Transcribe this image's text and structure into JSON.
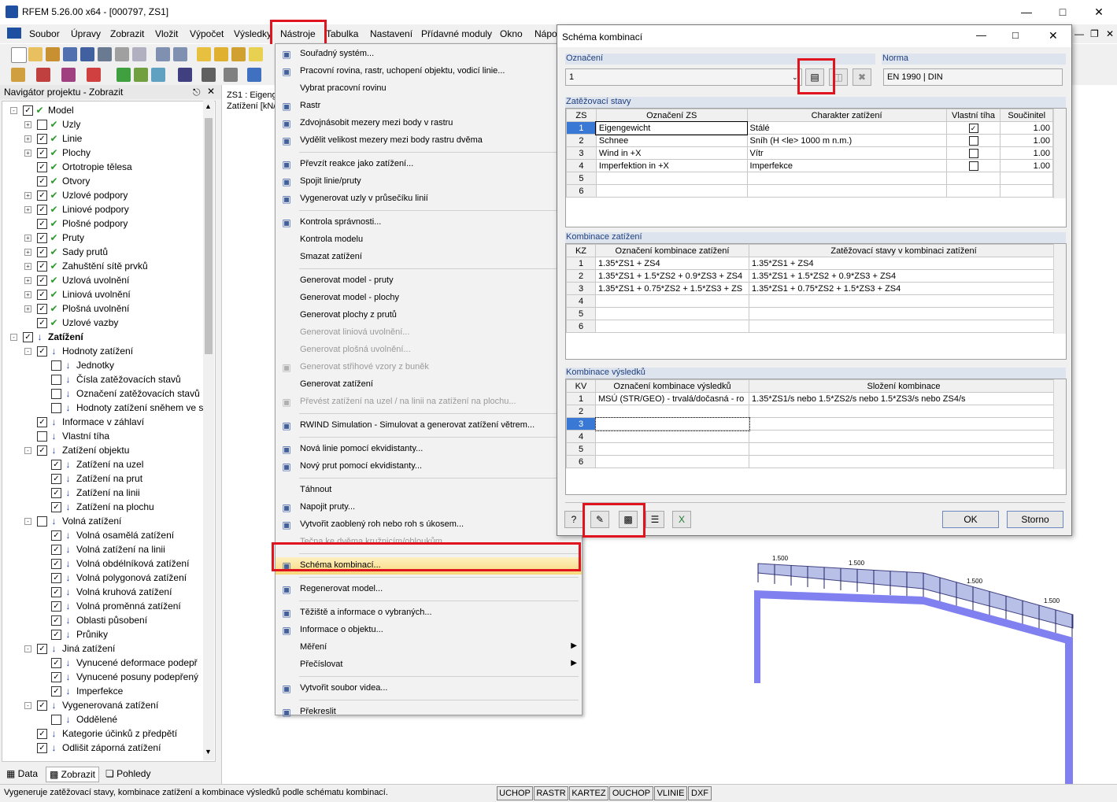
{
  "app": {
    "title": "RFEM 5.26.00 x64 - [000797, ZS1]"
  },
  "menubar": {
    "items": [
      "Soubor",
      "Úpravy",
      "Zobrazit",
      "Vložit",
      "Výpočet",
      "Výsledky",
      "Nástroje",
      "Tabulka",
      "Nastavení",
      "Přídavné moduly",
      "Okno",
      "Nápo"
    ]
  },
  "navigator": {
    "title": "Navigátor projektu - Zobrazit",
    "tree": [
      {
        "label": "Model",
        "level": 0,
        "exp": "-",
        "cb": "x",
        "icon": "model-icon"
      },
      {
        "label": "Uzly",
        "level": 1,
        "exp": "+",
        "cb": "",
        "icon": "check-icon"
      },
      {
        "label": "Linie",
        "level": 1,
        "exp": "+",
        "cb": "x",
        "icon": "check-icon"
      },
      {
        "label": "Plochy",
        "level": 1,
        "exp": "+",
        "cb": "x",
        "icon": "check-icon"
      },
      {
        "label": "Ortotropie tělesa",
        "level": 1,
        "exp": "",
        "cb": "x",
        "icon": "check-icon"
      },
      {
        "label": "Otvory",
        "level": 1,
        "exp": "",
        "cb": "x",
        "icon": "check-icon"
      },
      {
        "label": "Uzlové podpory",
        "level": 1,
        "exp": "+",
        "cb": "x",
        "icon": "check-icon"
      },
      {
        "label": "Liniové podpory",
        "level": 1,
        "exp": "+",
        "cb": "x",
        "icon": "check-icon"
      },
      {
        "label": "Plošné podpory",
        "level": 1,
        "exp": "",
        "cb": "x",
        "icon": "check-icon"
      },
      {
        "label": "Pruty",
        "level": 1,
        "exp": "+",
        "cb": "x",
        "icon": "check-icon"
      },
      {
        "label": "Sady prutů",
        "level": 1,
        "exp": "+",
        "cb": "x",
        "icon": "check-icon"
      },
      {
        "label": "Zahuštění sítě prvků",
        "level": 1,
        "exp": "+",
        "cb": "x",
        "icon": "check-icon"
      },
      {
        "label": "Uzlová uvolnění",
        "level": 1,
        "exp": "+",
        "cb": "x",
        "icon": "check-icon"
      },
      {
        "label": "Liniová uvolnění",
        "level": 1,
        "exp": "+",
        "cb": "x",
        "icon": "check-icon"
      },
      {
        "label": "Plošná uvolnění",
        "level": 1,
        "exp": "+",
        "cb": "x",
        "icon": "check-icon"
      },
      {
        "label": "Uzlové vazby",
        "level": 1,
        "exp": "",
        "cb": "x",
        "icon": "check-icon"
      },
      {
        "label": "Zatížení",
        "level": 0,
        "exp": "-",
        "cb": "x",
        "icon": "load-icon",
        "bold": true
      },
      {
        "label": "Hodnoty zatížení",
        "level": 1,
        "exp": "-",
        "cb": "x",
        "icon": "load-icon"
      },
      {
        "label": "Jednotky",
        "level": 2,
        "exp": "",
        "cb": "",
        "icon": "load-icon"
      },
      {
        "label": "Čísla zatěžovacích stavů",
        "level": 2,
        "exp": "",
        "cb": "",
        "icon": "load-icon"
      },
      {
        "label": "Označení zatěžovacích stavů",
        "level": 2,
        "exp": "",
        "cb": "",
        "icon": "load-icon"
      },
      {
        "label": "Hodnoty zatížení sněhem ve s",
        "level": 2,
        "exp": "",
        "cb": "",
        "icon": "load-icon"
      },
      {
        "label": "Informace v záhlaví",
        "level": 1,
        "exp": "",
        "cb": "x",
        "icon": "load-icon"
      },
      {
        "label": "Vlastní tíha",
        "level": 1,
        "exp": "",
        "cb": "",
        "icon": "load-icon"
      },
      {
        "label": "Zatížení objektu",
        "level": 1,
        "exp": "-",
        "cb": "x",
        "icon": "load-icon"
      },
      {
        "label": "Zatížení na uzel",
        "level": 2,
        "exp": "",
        "cb": "x",
        "icon": "load-icon"
      },
      {
        "label": "Zatížení na prut",
        "level": 2,
        "exp": "",
        "cb": "x",
        "icon": "load-icon"
      },
      {
        "label": "Zatížení na linii",
        "level": 2,
        "exp": "",
        "cb": "x",
        "icon": "load-icon"
      },
      {
        "label": "Zatížení na plochu",
        "level": 2,
        "exp": "",
        "cb": "x",
        "icon": "load-icon"
      },
      {
        "label": "Volná zatížení",
        "level": 1,
        "exp": "-",
        "cb": "",
        "icon": "load-icon"
      },
      {
        "label": "Volná osamělá zatížení",
        "level": 2,
        "exp": "",
        "cb": "x",
        "icon": "load-icon"
      },
      {
        "label": "Volná zatížení na linii",
        "level": 2,
        "exp": "",
        "cb": "x",
        "icon": "load-icon"
      },
      {
        "label": "Volná obdélníková zatížení",
        "level": 2,
        "exp": "",
        "cb": "x",
        "icon": "load-icon"
      },
      {
        "label": "Volná polygonová zatížení",
        "level": 2,
        "exp": "",
        "cb": "x",
        "icon": "load-icon"
      },
      {
        "label": "Volná kruhová zatížení",
        "level": 2,
        "exp": "",
        "cb": "x",
        "icon": "load-icon"
      },
      {
        "label": "Volná proměnná zatížení",
        "level": 2,
        "exp": "",
        "cb": "x",
        "icon": "load-icon"
      },
      {
        "label": "Oblasti působení",
        "level": 2,
        "exp": "",
        "cb": "x",
        "icon": "load-icon"
      },
      {
        "label": "Průniky",
        "level": 2,
        "exp": "",
        "cb": "x",
        "icon": "load-icon"
      },
      {
        "label": "Jiná zatížení",
        "level": 1,
        "exp": "-",
        "cb": "x",
        "icon": "load-icon"
      },
      {
        "label": "Vynucené deformace podepř",
        "level": 2,
        "exp": "",
        "cb": "x",
        "icon": "load-icon"
      },
      {
        "label": "Vynucené posuny podepřený",
        "level": 2,
        "exp": "",
        "cb": "x",
        "icon": "load-icon"
      },
      {
        "label": "Imperfekce",
        "level": 2,
        "exp": "",
        "cb": "x",
        "icon": "load-icon"
      },
      {
        "label": "Vygenerovaná zatížení",
        "level": 1,
        "exp": "-",
        "cb": "x",
        "icon": "load-icon"
      },
      {
        "label": "Oddělené",
        "level": 2,
        "exp": "",
        "cb": "",
        "icon": "load-icon"
      },
      {
        "label": "Kategorie účinků z předpětí",
        "level": 1,
        "exp": "",
        "cb": "x",
        "icon": "load-icon"
      },
      {
        "label": "Odlišit záporná zatížení",
        "level": 1,
        "exp": "",
        "cb": "x",
        "icon": "load-icon"
      }
    ],
    "tabs": [
      "Data",
      "Zobrazit",
      "Pohledy"
    ]
  },
  "workarea": {
    "line1": "ZS1 : Eigeng",
    "line2": "Zatížení [kN/",
    "load_labels": [
      "1.500",
      "1.500",
      "1.500",
      "1.500"
    ]
  },
  "toolsmenu": {
    "items": [
      {
        "label": "Souřadný systém...",
        "icon": "coordinate-icon"
      },
      {
        "label": "Pracovní rovina, rastr, uchopení objektu, vodicí linie...",
        "icon": "workplane-icon"
      },
      {
        "label": "Vybrat pracovní rovinu",
        "icon": ""
      },
      {
        "label": "Rastr",
        "icon": "grid-icon"
      },
      {
        "label": "Zdvojnásobit mezery mezi body v rastru",
        "icon": "double-icon"
      },
      {
        "label": "Vydělit velikost mezery mezi body rastru dvěma",
        "icon": "halve-icon"
      },
      {
        "sep": true
      },
      {
        "label": "Převzít reakce jako zatížení...",
        "icon": "reaction-icon"
      },
      {
        "label": "Spojit linie/pruty",
        "icon": "connect-icon"
      },
      {
        "label": "Vygenerovat uzly v průsečíku linií",
        "icon": "intersect-icon"
      },
      {
        "sep": true
      },
      {
        "label": "Kontrola správnosti...",
        "icon": "check-model-icon"
      },
      {
        "label": "Kontrola modelu",
        "icon": ""
      },
      {
        "label": "Smazat zatížení",
        "icon": ""
      },
      {
        "sep": true
      },
      {
        "label": "Generovat model - pruty",
        "icon": ""
      },
      {
        "label": "Generovat model - plochy",
        "icon": ""
      },
      {
        "label": "Generovat plochy z prutů",
        "icon": ""
      },
      {
        "label": "Generovat liniová uvolnění...",
        "icon": "",
        "disabled": true
      },
      {
        "label": "Generovat plošná uvolnění...",
        "icon": "",
        "disabled": true
      },
      {
        "label": "Generovat střihové vzory z buněk",
        "icon": "pattern-icon",
        "disabled": true
      },
      {
        "label": "Generovat zatížení",
        "icon": ""
      },
      {
        "label": "Převést zatížení na uzel / na linii na zatížení na plochu...",
        "icon": "convert-icon",
        "disabled": true
      },
      {
        "sep": true
      },
      {
        "label": "RWIND Simulation - Simulovat a generovat zatížení větrem...",
        "icon": "rwind-icon"
      },
      {
        "sep": true
      },
      {
        "label": "Nová linie pomocí ekvidistanty...",
        "icon": "line-offset-icon"
      },
      {
        "label": "Nový prut pomocí ekvidistanty...",
        "icon": "member-offset-icon"
      },
      {
        "sep": true
      },
      {
        "label": "Táhnout",
        "icon": ""
      },
      {
        "label": "Napojit pruty...",
        "icon": "join-icon"
      },
      {
        "label": "Vytvořit zaoblený roh nebo roh s úkosem...",
        "icon": "fillet-icon"
      },
      {
        "label": "Tečna ke dvěma kružnicím/obloukům...",
        "icon": "",
        "disabled": true
      },
      {
        "sep": true
      },
      {
        "label": "Schéma kombinací...",
        "icon": "combination-icon",
        "highlight": true
      },
      {
        "sep": true
      },
      {
        "label": "Regenerovat model...",
        "icon": "regenerate-icon"
      },
      {
        "sep": true
      },
      {
        "label": "Těžiště a informace o vybraných...",
        "icon": "centroid-icon"
      },
      {
        "label": "Informace o objektu...",
        "icon": "info-icon"
      },
      {
        "label": "Měření",
        "icon": "",
        "submenu": true
      },
      {
        "label": "Přečíslovat",
        "icon": "",
        "submenu": true
      },
      {
        "sep": true
      },
      {
        "label": "Vytvořit soubor videa...",
        "icon": "video-icon"
      },
      {
        "sep": true
      },
      {
        "label": "Překreslit",
        "icon": "pencil-icon"
      }
    ]
  },
  "dialog": {
    "title": "Schéma kombinací",
    "oznaceni_label": "Označení",
    "oznaceni_value": "1",
    "norma_label": "Norma",
    "norma_value": "EN 1990 | DIN",
    "zs": {
      "title": "Zatěžovací stavy",
      "headers": [
        "ZS",
        "Označení ZS",
        "Charakter zatížení",
        "Vlastní tíha",
        "Součinitel"
      ],
      "rows": [
        {
          "n": "1",
          "name": "Eigengewicht",
          "char": "Stálé",
          "self": true,
          "f": "1.00"
        },
        {
          "n": "2",
          "name": "Schnee",
          "char": "Sníh (H <le> 1000 m n.m.)",
          "self": false,
          "f": "1.00"
        },
        {
          "n": "3",
          "name": "Wind in +X",
          "char": "Vítr",
          "self": false,
          "f": "1.00"
        },
        {
          "n": "4",
          "name": "Imperfektion in +X",
          "char": "Imperfekce",
          "self": false,
          "f": "1.00"
        },
        {
          "n": "5",
          "name": "",
          "char": "",
          "self": null,
          "f": ""
        },
        {
          "n": "6",
          "name": "",
          "char": "",
          "self": null,
          "f": ""
        }
      ]
    },
    "kz": {
      "title": "Kombinace zatížení",
      "headers": [
        "KZ",
        "Označení kombinace zatížení",
        "Zatěžovací stavy v kombinaci zatížení"
      ],
      "rows": [
        {
          "n": "1",
          "a": "1.35*ZS1 + ZS4",
          "b": "1.35*ZS1 + ZS4"
        },
        {
          "n": "2",
          "a": "1.35*ZS1 + 1.5*ZS2 + 0.9*ZS3 + ZS4",
          "b": "1.35*ZS1 + 1.5*ZS2 + 0.9*ZS3 + ZS4"
        },
        {
          "n": "3",
          "a": "1.35*ZS1 + 0.75*ZS2 + 1.5*ZS3 + ZS",
          "b": "1.35*ZS1 + 0.75*ZS2 + 1.5*ZS3 + ZS4"
        },
        {
          "n": "4",
          "a": "",
          "b": ""
        },
        {
          "n": "5",
          "a": "",
          "b": ""
        },
        {
          "n": "6",
          "a": "",
          "b": ""
        }
      ]
    },
    "kv": {
      "title": "Kombinace výsledků",
      "headers": [
        "KV",
        "Označení kombinace výsledků",
        "Složení kombinace"
      ],
      "rows": [
        {
          "n": "1",
          "a": "MSÚ (STR/GEO) - trvalá/dočasná - ro",
          "b": "1.35*ZS1/s nebo 1.5*ZS2/s nebo 1.5*ZS3/s nebo ZS4/s"
        },
        {
          "n": "2",
          "a": "",
          "b": ""
        },
        {
          "n": "3",
          "a": "",
          "b": ""
        },
        {
          "n": "4",
          "a": "",
          "b": ""
        },
        {
          "n": "5",
          "a": "",
          "b": ""
        },
        {
          "n": "6",
          "a": "",
          "b": ""
        }
      ]
    },
    "ok_label": "OK",
    "cancel_label": "Storno"
  },
  "status": {
    "text": "Vygeneruje zatěžovací stavy, kombinace zatížení a kombinace výsledků podle schématu kombinací.",
    "buttons": [
      "UCHOP",
      "RASTR",
      "KARTEZ",
      "OUCHOP",
      "VLINIE",
      "DXF"
    ]
  },
  "colors": {
    "highlight": "#e0141e",
    "selection": "#3a78d6",
    "section_header": "#dde4ee"
  }
}
